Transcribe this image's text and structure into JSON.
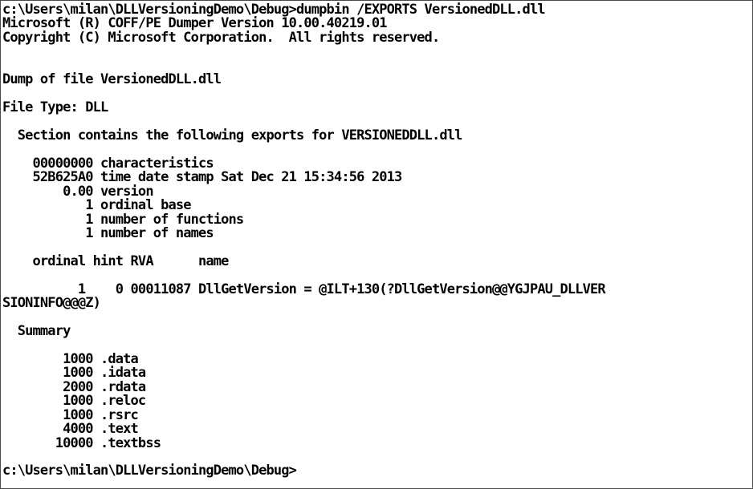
{
  "console": {
    "lines": [
      "c:\\Users\\milan\\DLLVersioningDemo\\Debug>dumpbin /EXPORTS VersionedDLL.dll",
      "Microsoft (R) COFF/PE Dumper Version 10.00.40219.01",
      "Copyright (C) Microsoft Corporation.  All rights reserved.",
      "",
      "",
      "Dump of file VersionedDLL.dll",
      "",
      "File Type: DLL",
      "",
      "  Section contains the following exports for VERSIONEDDLL.dll",
      "",
      "    00000000 characteristics",
      "    52B625A0 time date stamp Sat Dec 21 15:34:56 2013",
      "        0.00 version",
      "           1 ordinal base",
      "           1 number of functions",
      "           1 number of names",
      "",
      "    ordinal hint RVA      name",
      "",
      "          1    0 00011087 DllGetVersion = @ILT+130(?DllGetVersion@@YGJPAU_DLLVER",
      "SIONINFO@@@Z)",
      "",
      "  Summary",
      "",
      "        1000 .data",
      "        1000 .idata",
      "        2000 .rdata",
      "        1000 .reloc",
      "        1000 .rsrc",
      "        4000 .text",
      "       10000 .textbss",
      "",
      "c:\\Users\\milan\\DLLVersioningDemo\\Debug>"
    ]
  }
}
